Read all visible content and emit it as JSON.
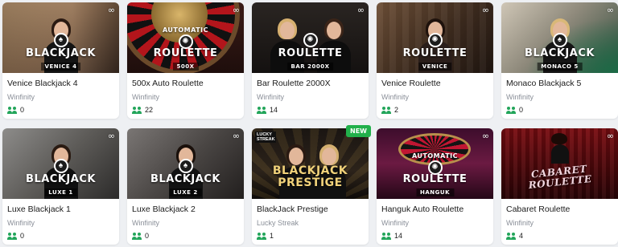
{
  "colors": {
    "players_icon": "#22a55a",
    "new_badge": "#21b04b"
  },
  "games": [
    {
      "id": "venice-blackjack-4",
      "name": "Venice Blackjack 4",
      "provider": "Winfinity",
      "players": "0",
      "thumb": {
        "pretitle": "",
        "title": "BLACKJACK",
        "subtitle": "VENICE 4",
        "theme": "warm"
      }
    },
    {
      "id": "500x-auto-roulette",
      "name": "500x Auto Roulette",
      "provider": "Winfinity",
      "players": "22",
      "thumb": {
        "pretitle": "AUTOMATIC",
        "title": "ROULETTE",
        "subtitle": "500X",
        "theme": "wheel-red"
      }
    },
    {
      "id": "bar-roulette-2000x",
      "name": "Bar Roulette 2000X",
      "provider": "Winfinity",
      "players": "14",
      "thumb": {
        "pretitle": "",
        "title": "ROULETTE",
        "subtitle": "BAR 2000X",
        "theme": "dark"
      }
    },
    {
      "id": "venice-roulette",
      "name": "Venice Roulette",
      "provider": "Winfinity",
      "players": "2",
      "thumb": {
        "pretitle": "",
        "title": "ROULETTE",
        "subtitle": "VENICE",
        "theme": "brown"
      }
    },
    {
      "id": "monaco-blackjack-5",
      "name": "Monaco Blackjack 5",
      "provider": "Winfinity",
      "players": "0",
      "thumb": {
        "pretitle": "",
        "title": "BLACKJACK",
        "subtitle": "MONACO 5",
        "theme": "green"
      }
    },
    {
      "id": "luxe-blackjack-1",
      "name": "Luxe Blackjack 1",
      "provider": "Winfinity",
      "players": "0",
      "thumb": {
        "pretitle": "",
        "title": "BLACKJACK",
        "subtitle": "LUXE 1",
        "theme": "grey"
      }
    },
    {
      "id": "luxe-blackjack-2",
      "name": "Luxe Blackjack 2",
      "provider": "Winfinity",
      "players": "0",
      "thumb": {
        "pretitle": "",
        "title": "BLACKJACK",
        "subtitle": "LUXE 2",
        "theme": "grey-dark"
      }
    },
    {
      "id": "blackjack-prestige",
      "name": "BlackJack Prestige",
      "provider": "Lucky Streak",
      "players": "1",
      "badge": "NEW",
      "logo": "LUCKY STREAK",
      "thumb": {
        "pretitle": "",
        "title": "BLACKJACK PRESTIGE",
        "subtitle": "",
        "theme": "gold"
      }
    },
    {
      "id": "hanguk-auto-roulette",
      "name": "Hanguk Auto Roulette",
      "provider": "Winfinity",
      "players": "14",
      "thumb": {
        "pretitle": "AUTOMATIC",
        "title": "ROULETTE",
        "subtitle": "HANGUK",
        "theme": "purple"
      }
    },
    {
      "id": "cabaret-roulette",
      "name": "Cabaret Roulette",
      "provider": "Winfinity",
      "players": "4",
      "thumb": {
        "pretitle": "",
        "title": "CABARET ROULETTE",
        "subtitle": "",
        "theme": "crimson"
      }
    }
  ]
}
